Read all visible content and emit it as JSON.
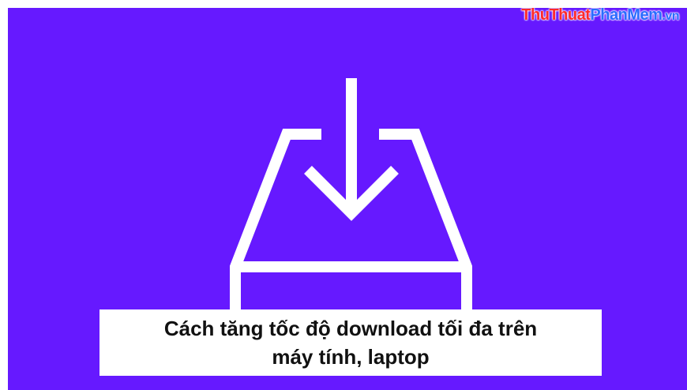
{
  "banner": {
    "background_color": "#6619ff",
    "icon": "download-tray-icon",
    "icon_color": "#ffffff"
  },
  "logo": {
    "part1": "Thu",
    "part2": "Thuat",
    "part3": "Phan",
    "part4": "Mem",
    "part5": ".vn"
  },
  "caption": {
    "line1": "Cách tăng tốc độ download tối đa trên",
    "line2": "máy tính, laptop"
  }
}
